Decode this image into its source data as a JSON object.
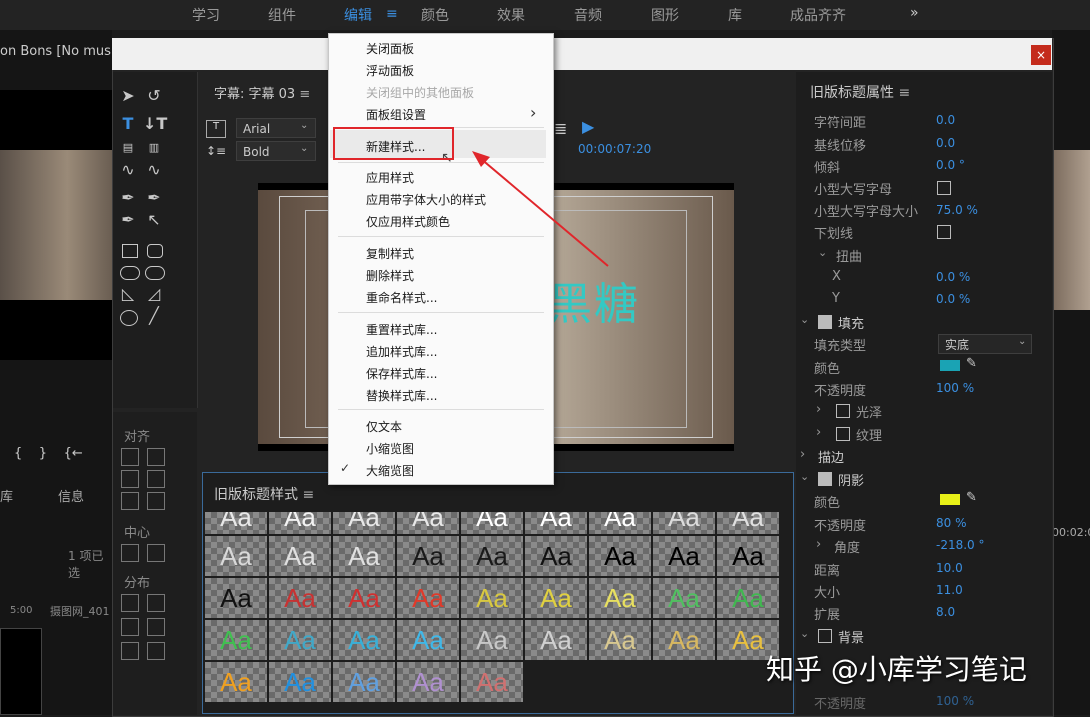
{
  "colors": {
    "accent": "#3b8fe0",
    "highlight_box": "#e0262b",
    "arrow": "#e0262b",
    "title_text": "#33c9c4",
    "fill_swatch": "#1aa3b4",
    "shadow_swatch": "#e8f018"
  },
  "workspace_tabs": [
    "学习",
    "组件",
    "编辑",
    "颜色",
    "效果",
    "音频",
    "图形",
    "库",
    "成品齐齐"
  ],
  "workspace_active": "编辑",
  "workspace_more": "»",
  "background_sequence_title": "on Bons [No music].m",
  "background_left": {
    "tab_ku": "库",
    "tab_info": "信息",
    "items_count": "1 项已选",
    "time": "5:00",
    "clip_name": "摄图网_401"
  },
  "dialog": {
    "close_label": "×"
  },
  "tools": {
    "align_label": "对齐",
    "center_label": "中心",
    "distribute_label": "分布"
  },
  "editor": {
    "tab_title": "字幕: 字幕 03",
    "font_family": "Arial",
    "font_style": "Bold",
    "timecode": "00:00:07:20",
    "title_text": "黑糖"
  },
  "styles_panel": {
    "title": "旧版标题样式",
    "swatch_label": "Aa"
  },
  "properties": {
    "title": "旧版标题属性",
    "rows": [
      {
        "label": "字符间距",
        "value": "0.0"
      },
      {
        "label": "基线位移",
        "value": "0.0"
      },
      {
        "label": "倾斜",
        "value": "0.0 °"
      },
      {
        "label": "小型大写字母",
        "value": ""
      },
      {
        "label": "小型大写字母大小",
        "value": "75.0 %"
      },
      {
        "label": "下划线",
        "value": ""
      },
      {
        "label": "扭曲",
        "value": ""
      },
      {
        "label": "X",
        "value": "0.0 %"
      },
      {
        "label": "Y",
        "value": "0.0 %"
      },
      {
        "label": "填充",
        "value": ""
      },
      {
        "label": "填充类型",
        "value": "实底"
      },
      {
        "label": "颜色",
        "value": ""
      },
      {
        "label": "不透明度",
        "value": "100 %"
      },
      {
        "label": "光泽",
        "value": ""
      },
      {
        "label": "纹理",
        "value": ""
      },
      {
        "label": "描边",
        "value": ""
      },
      {
        "label": "阴影",
        "value": ""
      },
      {
        "label": "颜色",
        "value": ""
      },
      {
        "label": "不透明度",
        "value": "80 %"
      },
      {
        "label": "角度",
        "value": "-218.0 °"
      },
      {
        "label": "距离",
        "value": "10.0"
      },
      {
        "label": "大小",
        "value": "11.0"
      },
      {
        "label": "扩展",
        "value": "8.0"
      },
      {
        "label": "背景",
        "value": ""
      },
      {
        "label": "不透明度",
        "value": "100 %"
      }
    ]
  },
  "right_edge_timecode": "00:02:0",
  "menu": {
    "items": [
      {
        "label": "关闭面板",
        "disabled": false
      },
      {
        "label": "浮动面板",
        "disabled": false
      },
      {
        "label": "关闭组中的其他面板",
        "disabled": true
      },
      {
        "label": "面板组设置",
        "disabled": false,
        "submenu": true
      },
      {
        "label": "新建样式...",
        "disabled": false
      },
      {
        "label": "应用样式",
        "disabled": false
      },
      {
        "label": "应用带字体大小的样式",
        "disabled": false
      },
      {
        "label": "仅应用样式颜色",
        "disabled": false
      },
      {
        "label": "复制样式",
        "disabled": false
      },
      {
        "label": "删除样式",
        "disabled": false
      },
      {
        "label": "重命名样式...",
        "disabled": false
      },
      {
        "label": "重置样式库...",
        "disabled": false
      },
      {
        "label": "追加样式库...",
        "disabled": false
      },
      {
        "label": "保存样式库...",
        "disabled": false
      },
      {
        "label": "替换样式库...",
        "disabled": false
      },
      {
        "label": "仅文本",
        "disabled": false
      },
      {
        "label": "小缩览图",
        "disabled": false
      },
      {
        "label": "大缩览图",
        "disabled": false,
        "checked": true
      }
    ],
    "submenu_arrow": "›",
    "check_mark": "✓"
  },
  "watermark": "知乎 @小库学习笔记"
}
